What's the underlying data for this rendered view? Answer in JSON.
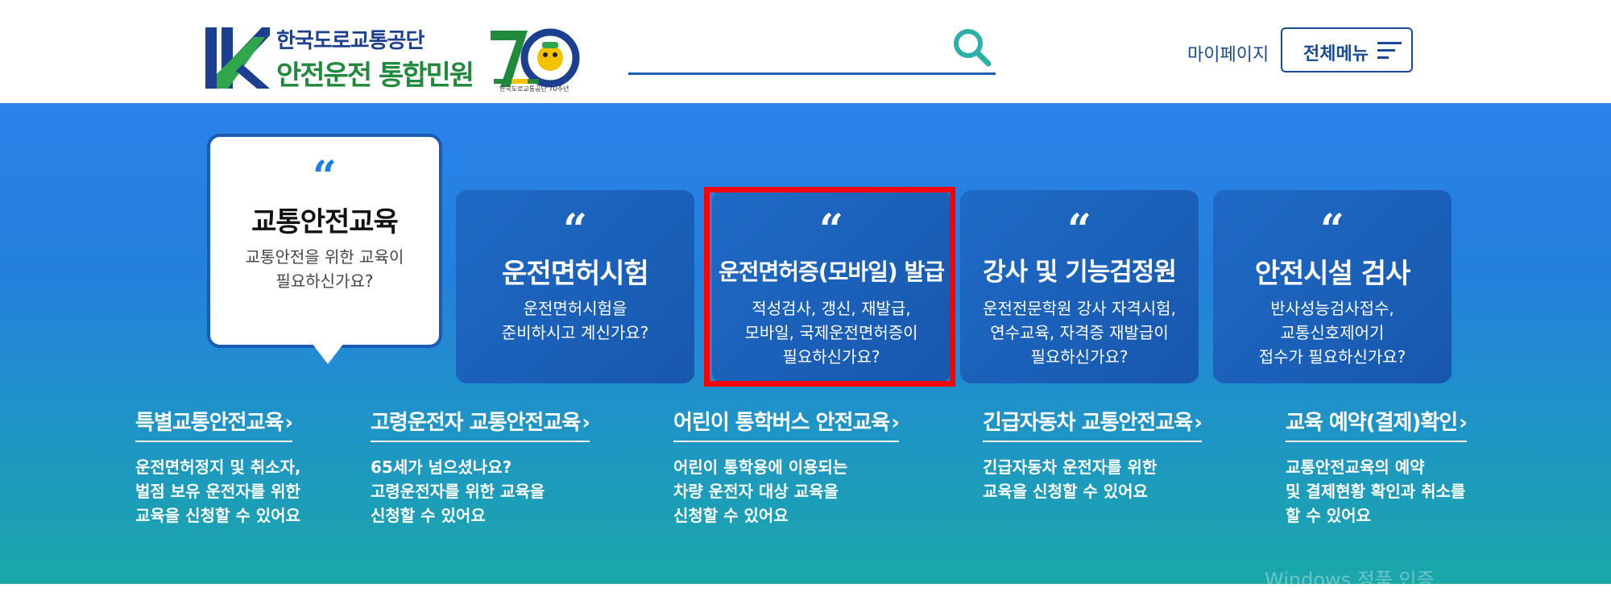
{
  "header": {
    "org_name": "한국도로교통공단",
    "site_name": "안전운전 통합민원",
    "anniversary_caption": "한국도로교통공단 70주년",
    "search_placeholder": "",
    "mypage_label": "마이페이지",
    "menu_label": "전체메뉴"
  },
  "featured": {
    "title": "교통안전교육",
    "desc": [
      "교통안전을 위한 교육이",
      "필요하신가요?"
    ]
  },
  "cards": [
    {
      "title": "운전면허시험",
      "desc": [
        "운전면허시험을",
        "준비하시고 계신가요?"
      ]
    },
    {
      "title": "운전면허증(모바일) 발급",
      "desc": [
        "적성검사, 갱신, 재발급,",
        "모바일, 국제운전면허증이",
        "필요하신가요?"
      ]
    },
    {
      "title": "강사 및 기능검정원",
      "desc": [
        "운전전문학원 강사 자격시험,",
        "연수교육, 자격증 재발급이",
        "필요하신가요?"
      ]
    },
    {
      "title": "안전시설 검사",
      "desc": [
        "반사성능검사접수,",
        "교통신호제어기",
        "접수가 필요하신가요?"
      ]
    }
  ],
  "links": [
    {
      "title": "특별교통안전교육",
      "desc": [
        "운전면허정지 및 취소자,",
        "벌점 보유 운전자를 위한",
        "교육을 신청할 수 있어요"
      ]
    },
    {
      "title": "고령운전자 교통안전교육",
      "desc": [
        "65세가 넘으셨나요?",
        "고령운전자를 위한 교육을",
        "신청할 수 있어요"
      ]
    },
    {
      "title": "어린이 통학버스 안전교육",
      "desc": [
        "어린이 통학용에 이용되는",
        "차량 운전자 대상 교육을",
        "신청할 수 있어요"
      ]
    },
    {
      "title": "긴급자동차 교통안전교육",
      "desc": [
        "긴급자동차 운전자를 위한",
        "교육을 신청할 수 있어요"
      ]
    },
    {
      "title": "교육 예약(결제)확인",
      "desc": [
        "교통안전교육의 예약",
        "및 결제현황 확인과 취소를",
        "할 수 있어요"
      ]
    }
  ],
  "watermark": "Windows 정품 인증",
  "colors": {
    "brand_blue": "#1a4a96",
    "brand_green": "#1f8a3c",
    "highlight_red": "#ff0000"
  }
}
